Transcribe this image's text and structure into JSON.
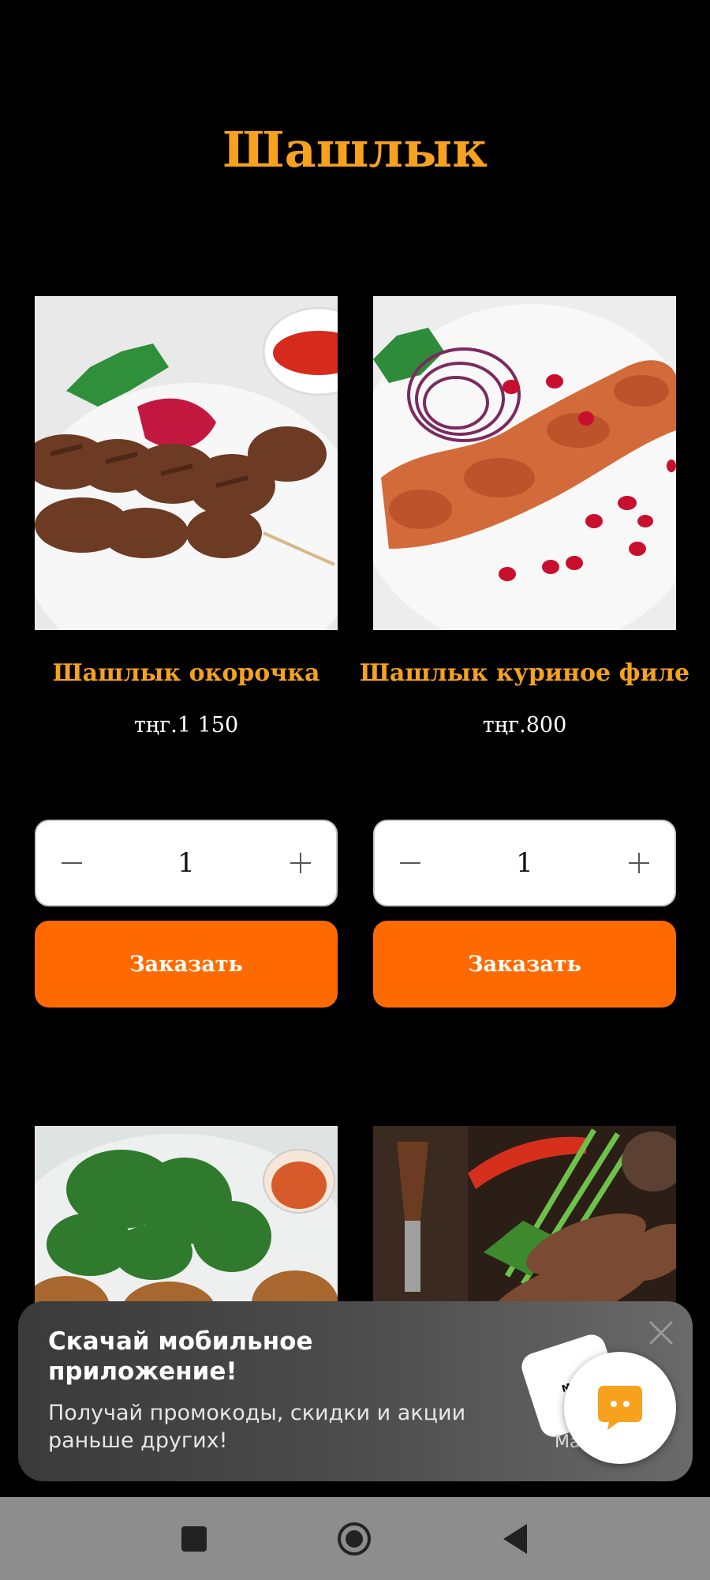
{
  "page": {
    "title": "Шашлык"
  },
  "products": [
    {
      "name": "Шашлык окорочка",
      "price": "тңг.1 150",
      "quantity": "1",
      "order_label": "Заказать"
    },
    {
      "name": "Шашлык куриное филе",
      "price": "тңг.800",
      "quantity": "1",
      "order_label": "Заказать"
    }
  ],
  "banner": {
    "title": "Скачай мобильное приложение!",
    "text": "Получай промокоды, скидки и акции раньше других!",
    "app_card_label": "Map",
    "cta_fragment": "Ma"
  },
  "icons": {
    "minus": "minus-icon",
    "plus": "plus-icon",
    "close": "close-icon",
    "chat": "chat-icon",
    "recents": "square-icon",
    "home": "circle-icon",
    "back": "triangle-back-icon"
  },
  "colors": {
    "accent": "#F6A21E",
    "button": "#FF6A00",
    "chat": "#F6A21E"
  }
}
